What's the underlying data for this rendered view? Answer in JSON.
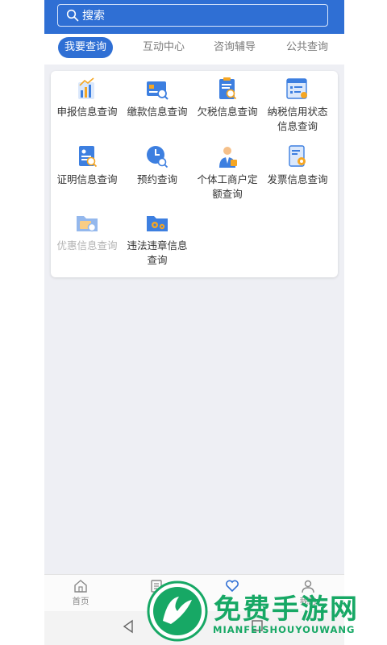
{
  "search": {
    "placeholder": "搜索"
  },
  "tabs": [
    {
      "label": "我要查询",
      "active": true
    },
    {
      "label": "互动中心"
    },
    {
      "label": "咨询辅导"
    },
    {
      "label": "公共查询"
    }
  ],
  "grid": [
    {
      "label": "申报信息查询",
      "icon": "bar-chart-document-icon"
    },
    {
      "label": "缴款信息查询",
      "icon": "payment-card-search-icon"
    },
    {
      "label": "欠税信息查询",
      "icon": "clipboard-search-icon"
    },
    {
      "label": "纳税信用状态信息查询",
      "icon": "credit-browser-icon"
    },
    {
      "label": "证明信息查询",
      "icon": "certificate-search-icon"
    },
    {
      "label": "预约查询",
      "icon": "clock-search-icon"
    },
    {
      "label": "个体工商户定额查询",
      "icon": "business-person-icon"
    },
    {
      "label": "发票信息查询",
      "icon": "invoice-gear-icon"
    },
    {
      "label": "优惠信息查询",
      "icon": "discount-folder-icon",
      "disabled": true
    },
    {
      "label": "违法违章信息查询",
      "icon": "folder-gear-icon"
    }
  ],
  "bottom_nav": [
    {
      "label": "首页",
      "icon": "home-icon"
    },
    {
      "label": "办",
      "icon": "document-icon"
    },
    {
      "label": "",
      "icon": "heart-icon",
      "active": true
    },
    {
      "label": "我的",
      "icon": "user-icon"
    }
  ],
  "watermark": {
    "title": "免费手游网",
    "subtitle": "MIANFEISHOUYOUWANG"
  },
  "colors": {
    "accent": "#2f6fd4",
    "background": "#eeeff4",
    "watermark": "#17a865"
  }
}
